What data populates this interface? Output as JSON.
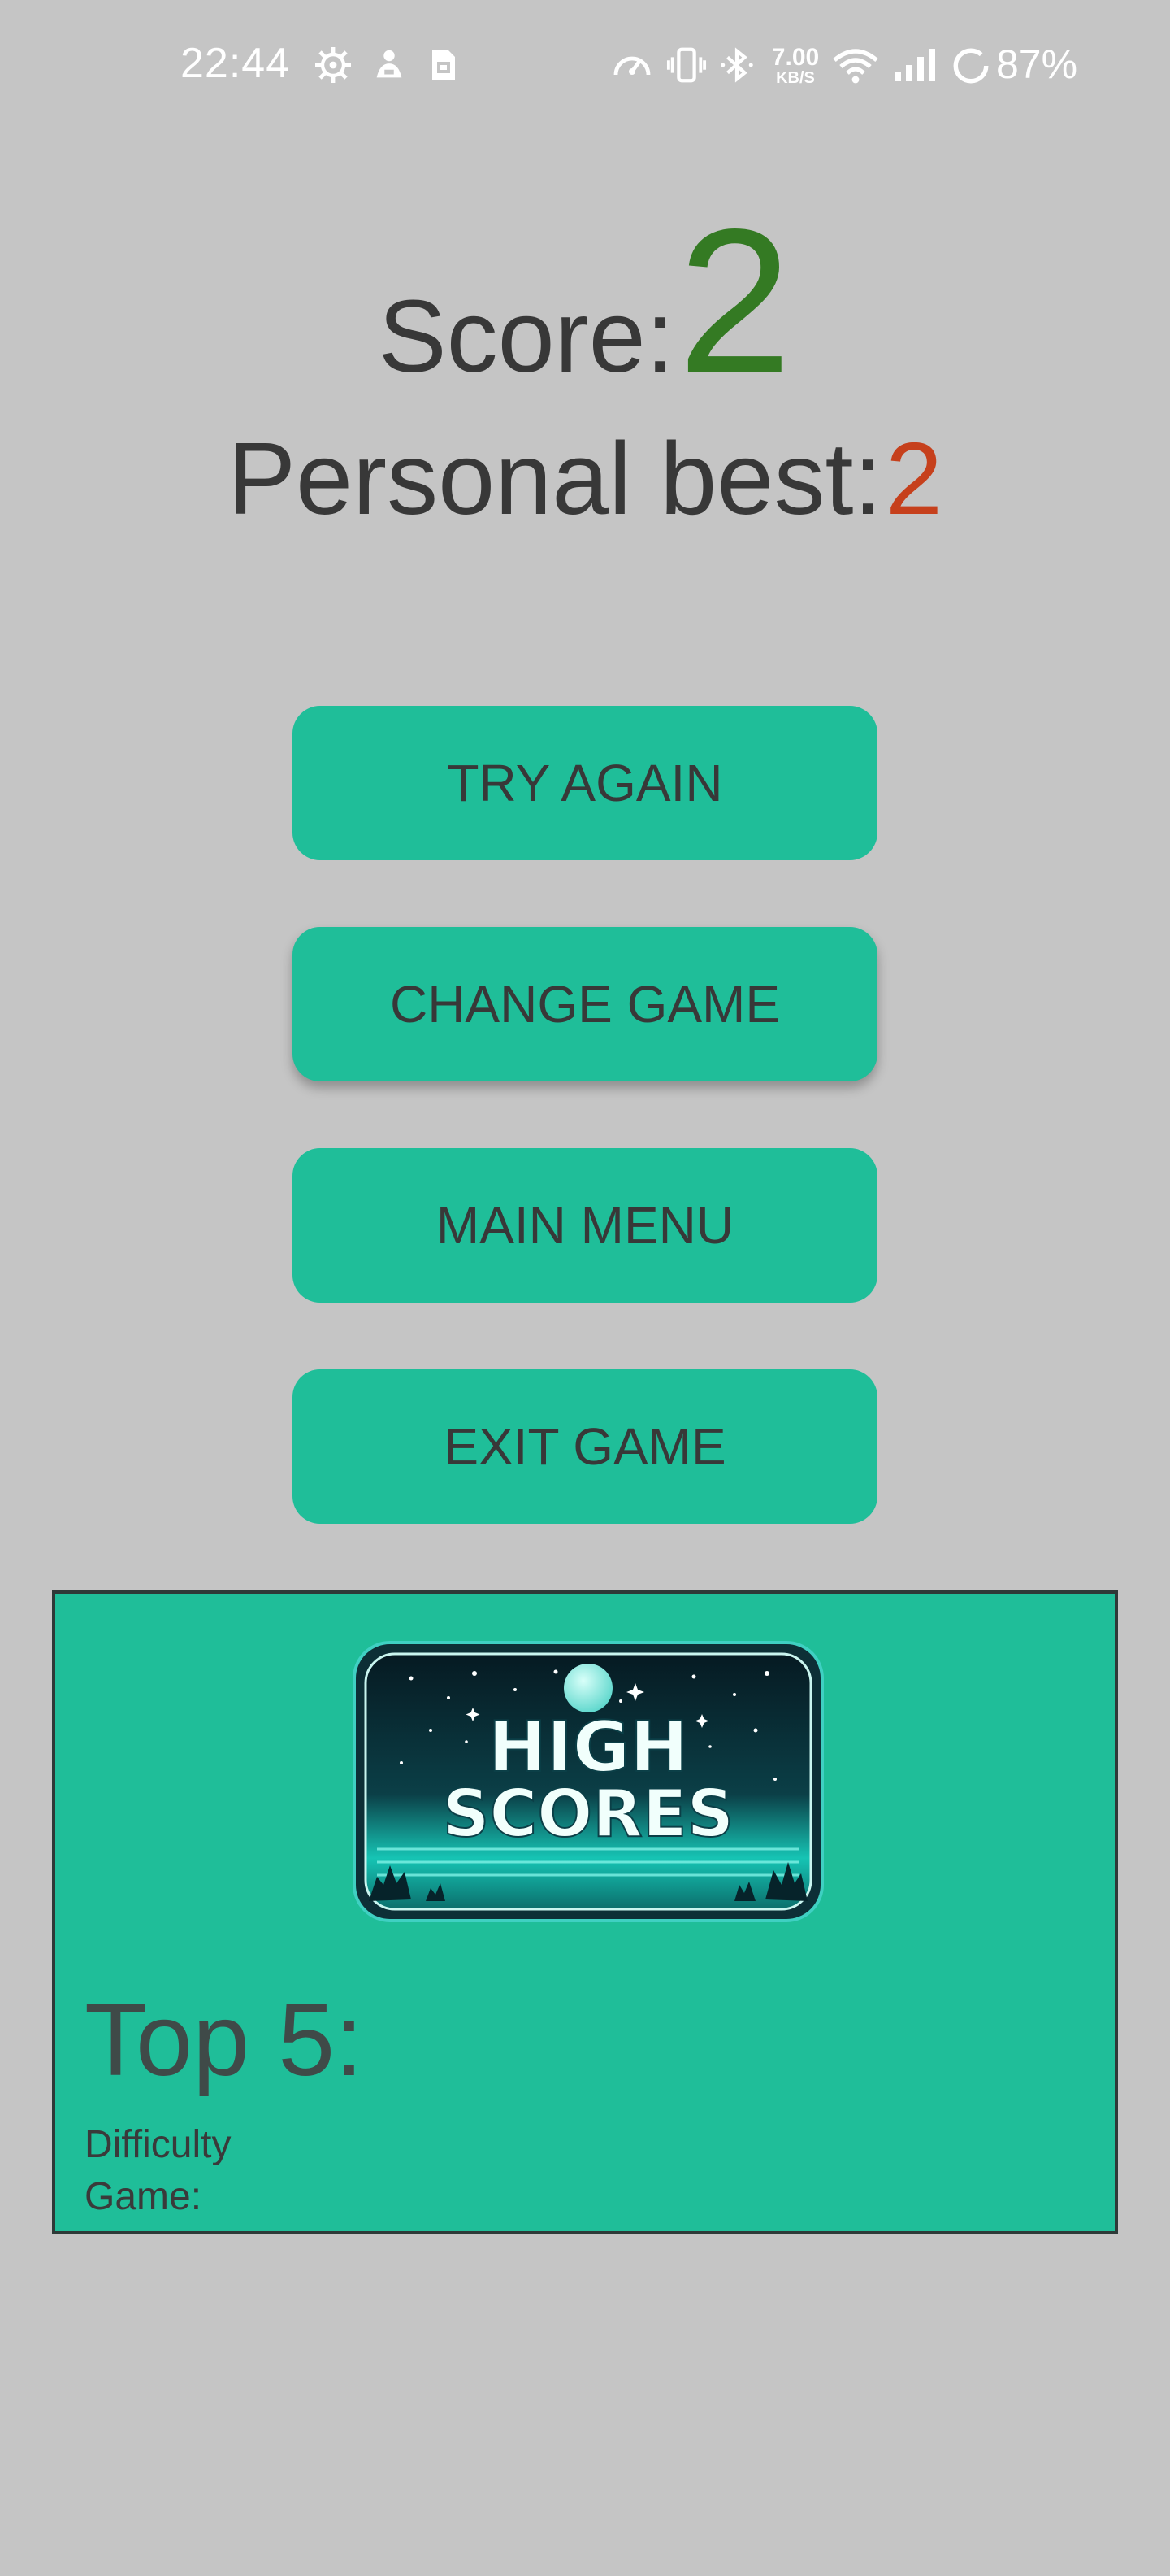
{
  "status_bar": {
    "time": "22:44",
    "net_speed_value": "7.00",
    "net_speed_unit": "KB/S",
    "battery_percent": "87%",
    "icons": [
      "settings-gear-icon",
      "game-mode-icon",
      "sim-card-icon",
      "speedometer-icon",
      "vibrate-icon",
      "bluetooth-icon",
      "wifi-icon",
      "signal-icon",
      "battery-ring-icon"
    ]
  },
  "score": {
    "label": "Score:",
    "value": "2",
    "value_color": "#347a23"
  },
  "personal_best": {
    "label": "Personal best:",
    "value": "2",
    "value_color": "#c6401c"
  },
  "buttons": {
    "try_again": "TRY AGAIN",
    "change_game": "CHANGE GAME",
    "main_menu": "MAIN MENU",
    "exit_game": "EXIT GAME"
  },
  "high_scores": {
    "logo_line1": "HIGH",
    "logo_line2": "SCORES",
    "top_heading": "Top 5:",
    "difficulty_label": "Difficulty",
    "game_label": "Game:"
  },
  "colors": {
    "background": "#c5c5c5",
    "accent": "#1fbe99",
    "text": "#383838"
  }
}
